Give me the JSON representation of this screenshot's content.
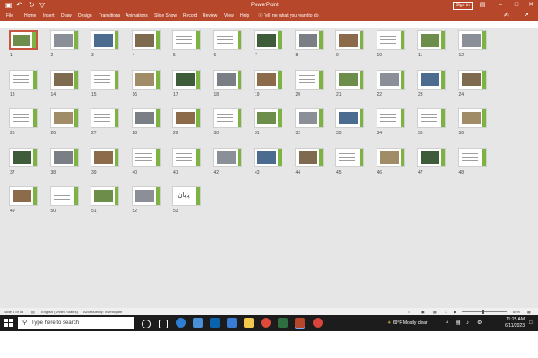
{
  "titlebar": {
    "title": "PowerPoint",
    "sign_in": "Sign in",
    "qa_icons": [
      "save-icon",
      "undo-icon",
      "redo-icon",
      "customize-icon"
    ],
    "window_controls": [
      "ribbon-display-icon",
      "minimize-icon",
      "maximize-icon",
      "close-icon"
    ]
  },
  "ribbon": {
    "tabs": [
      "File",
      "Home",
      "Insert",
      "Draw",
      "Design",
      "Transitions",
      "Animations",
      "Slide Show",
      "Record",
      "Review",
      "View",
      "Help"
    ],
    "tell_me": "Tell me what you want to do",
    "share_icons": [
      "comments-icon",
      "share-icon"
    ]
  },
  "slides": {
    "count": 53,
    "selected": 1,
    "last_slide_text": "پایان",
    "numbers": [
      "1",
      "2",
      "3",
      "4",
      "5",
      "6",
      "7",
      "8",
      "9",
      "10",
      "11",
      "12",
      "13",
      "14",
      "15",
      "16",
      "17",
      "18",
      "19",
      "20",
      "21",
      "22",
      "23",
      "24",
      "25",
      "26",
      "27",
      "28",
      "29",
      "30",
      "31",
      "32",
      "33",
      "34",
      "35",
      "36",
      "37",
      "38",
      "39",
      "40",
      "41",
      "42",
      "43",
      "44",
      "45",
      "46",
      "47",
      "48",
      "49",
      "50",
      "51",
      "52",
      "53"
    ]
  },
  "statusbar": {
    "slide_info": "Slide 1 of 53",
    "language": "English (United States)",
    "accessibility": "Accessibility: Investigate",
    "zoom": "65%"
  },
  "taskbar": {
    "search_placeholder": "Type here to search",
    "weather": "69°F  Mostly clear",
    "time": "11:25 AM",
    "date": "6/11/2023",
    "colors": {
      "accent": "#b7472a",
      "taskbar": "#1c1c1c"
    }
  }
}
